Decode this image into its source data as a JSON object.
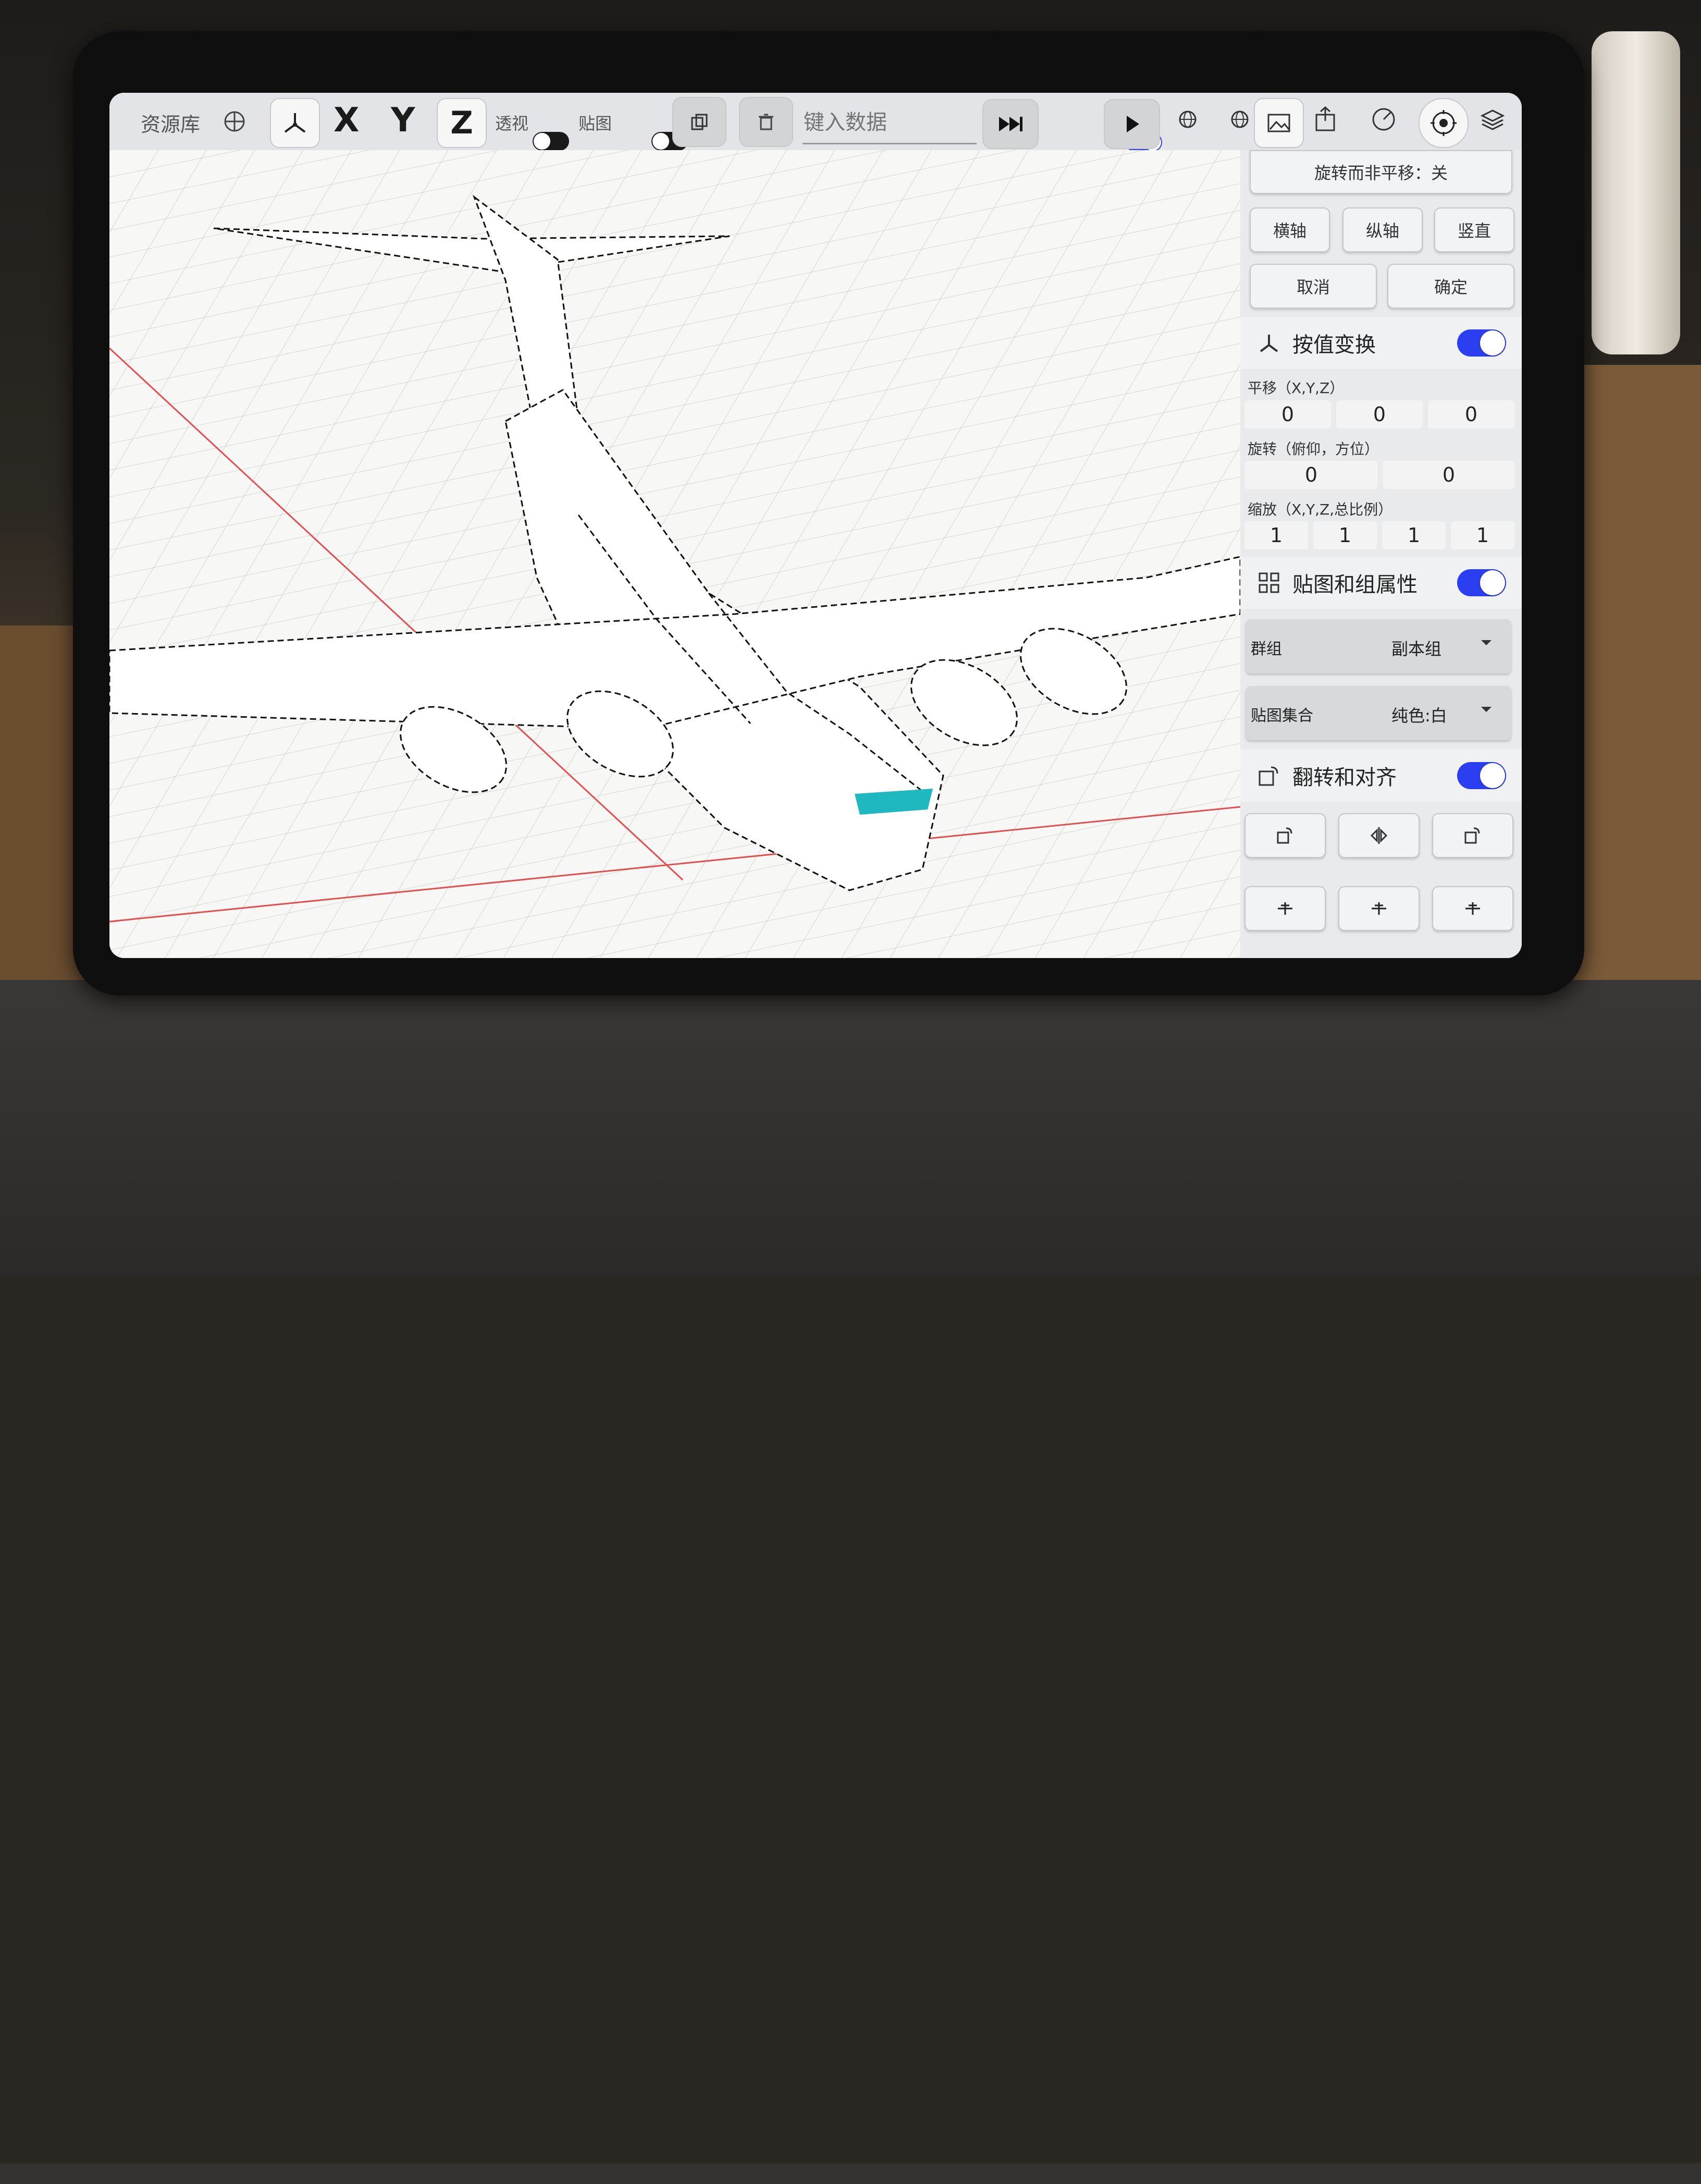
{
  "toolbar": {
    "library_label": "资源库",
    "axis_x": "X",
    "axis_y": "Y",
    "axis_z": "Z",
    "perspective_label": "透视",
    "texture_label": "贴图",
    "data_input_placeholder": "键入数据"
  },
  "panel": {
    "rotate_mode_label": "旋转而非平移：关",
    "btn_horizontal": "横轴",
    "btn_vertical_axis": "纵轴",
    "btn_upright": "竖直",
    "btn_cancel": "取消",
    "btn_confirm": "确定",
    "transform": {
      "title": "按值变换",
      "translate_label": "平移（X,Y,Z）",
      "translate": [
        "0",
        "0",
        "0"
      ],
      "rotate_label": "旋转（俯仰，方位）",
      "rotate": [
        "0",
        "0"
      ],
      "scale_label": "缩放（X,Y,Z,总比例）",
      "scale": [
        "1",
        "1",
        "1",
        "1"
      ]
    },
    "texture_group": {
      "title": "贴图和组属性",
      "group_label": "群组",
      "group_value": "副本组",
      "texture_set_label": "贴图集合",
      "texture_set_value": "纯色:白"
    },
    "flip_align": {
      "title": "翻转和对齐"
    }
  },
  "colors": {
    "accent": "#2c3ff0",
    "selection": "#1fb8c0",
    "axis_red": "#e05050"
  }
}
